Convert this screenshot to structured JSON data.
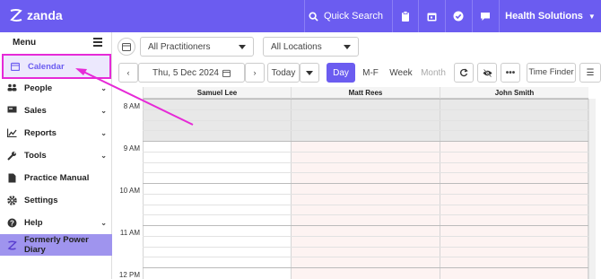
{
  "topbar": {
    "brand": "zanda",
    "quick_search": "Quick Search",
    "org_name": "Health Solutions",
    "colors": {
      "bar": "#6b5cf0"
    }
  },
  "sidebar": {
    "menu_label": "Menu",
    "items": [
      {
        "label": "Calendar",
        "icon": "calendar-icon",
        "selected": true
      },
      {
        "label": "People",
        "icon": "people-icon",
        "chevron": true
      },
      {
        "label": "Sales",
        "icon": "sales-icon",
        "chevron": true
      },
      {
        "label": "Reports",
        "icon": "chart-icon",
        "chevron": true
      },
      {
        "label": "Tools",
        "icon": "wrench-icon",
        "chevron": true
      },
      {
        "label": "Practice Manual",
        "icon": "document-icon"
      },
      {
        "label": "Settings",
        "icon": "gear-icon"
      },
      {
        "label": "Help",
        "icon": "help-icon",
        "chevron": true
      },
      {
        "label": "Formerly Power Diary",
        "icon": "zanda-logo-icon"
      }
    ]
  },
  "toolbar": {
    "practitioners": "All Practitioners",
    "locations": "All Locations",
    "date": "Thu, 5 Dec 2024",
    "today": "Today",
    "views": [
      "Day",
      "M-F",
      "Week",
      "Month"
    ],
    "active_view": "Day",
    "time_finder": "Time Finder"
  },
  "calendar": {
    "practitioners": [
      "Samuel Lee",
      "Matt Rees",
      "John Smith"
    ],
    "times": [
      "8 AM",
      "9 AM",
      "10 AM",
      "11 AM",
      "12 PM"
    ]
  }
}
